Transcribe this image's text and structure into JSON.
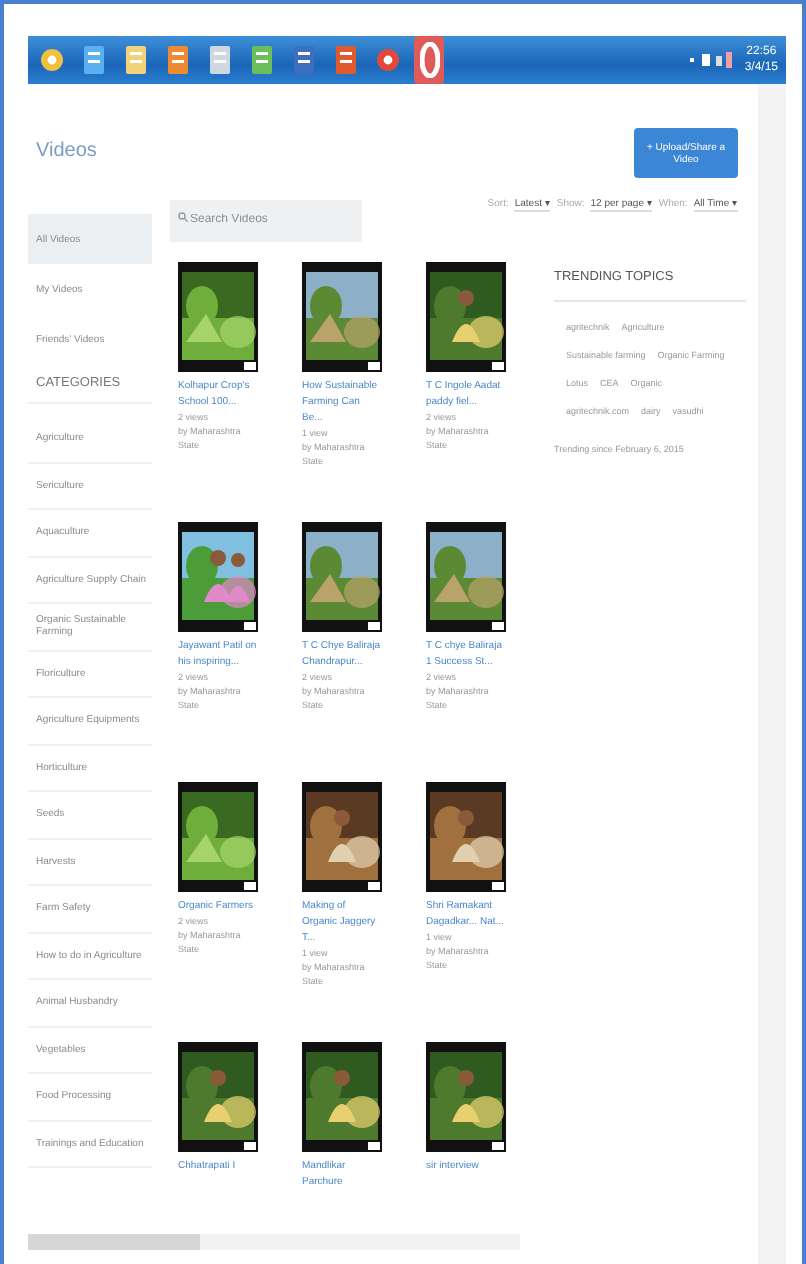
{
  "taskbar": {
    "apps": [
      {
        "kind": "start",
        "selected": false
      },
      {
        "kind": "ie",
        "selected": false
      },
      {
        "kind": "folder",
        "selected": false
      },
      {
        "kind": "media",
        "selected": false
      },
      {
        "kind": "doc",
        "selected": false
      },
      {
        "kind": "sheet",
        "selected": false
      },
      {
        "kind": "word",
        "selected": false
      },
      {
        "kind": "slides",
        "selected": false
      },
      {
        "kind": "chrome",
        "selected": false
      },
      {
        "kind": "opera",
        "selected": true
      }
    ],
    "clock": {
      "time": "22:56",
      "date": "3/4/15"
    }
  },
  "page": {
    "title": "Videos",
    "upload_button": "+ Upload/Share a Video"
  },
  "sidebar": {
    "items": [
      {
        "label": "All Videos",
        "selected": true
      },
      {
        "label": "My Videos",
        "selected": false
      },
      {
        "label": "Friends' Videos",
        "selected": false
      }
    ],
    "categories_heading": "CATEGORIES",
    "categories": [
      "Agriculture",
      "Sericulture",
      "Aquaculture",
      "Agriculture Supply Chain",
      "Organic Sustainable Farming",
      "Floriculture",
      "Agriculture Equipments",
      "Horticulture",
      "Seeds",
      "Harvests",
      "Farm Safety",
      "How to do in Agriculture",
      "Animal Husbandry",
      "Vegetables",
      "Food Processing",
      "Trainings and Education"
    ]
  },
  "search": {
    "placeholder": "Search Videos"
  },
  "filters": [
    {
      "label": "Sort:",
      "value": "Latest ▾"
    },
    {
      "label": "Show:",
      "value": "12 per page ▾"
    },
    {
      "label": "When:",
      "value": "All Time ▾"
    }
  ],
  "videos": [
    {
      "title": "Kolhapur Crop's School 100...",
      "views": "2 views",
      "author": "by Maharashtra State"
    },
    {
      "title": "How Sustainable Farming Can Be...",
      "views": "1 view",
      "author": "by Maharashtra State"
    },
    {
      "title": "T C Ingole Aadat paddy fiel...",
      "views": "2 views",
      "author": "by Maharashtra State"
    },
    {
      "title": "Jayawant Patil on his inspiring...",
      "views": "2 views",
      "author": "by Maharashtra State"
    },
    {
      "title": "T C Chye Baliraja Chandrapur...",
      "views": "2 views",
      "author": "by Maharashtra State"
    },
    {
      "title": "T C chye Baliraja 1 Success St...",
      "views": "2 views",
      "author": "by Maharashtra State"
    },
    {
      "title": "Organic Farmers",
      "views": "2 views",
      "author": "by Maharashtra State"
    },
    {
      "title": "Making of Organic Jaggery T...",
      "views": "1 view",
      "author": "by Maharashtra State"
    },
    {
      "title": "Shri Ramakant Dagadkar... Nat...",
      "views": "1 view",
      "author": "by Maharashtra State"
    },
    {
      "title": "Chhatrapati I"
    },
    {
      "title": "Mandlikar Parchure"
    },
    {
      "title": "sir interview"
    }
  ],
  "trending": {
    "heading": "TRENDING TOPICS",
    "tags": [
      "agritechnik",
      "Agriculture",
      "Sustainable farming",
      "Organic Farming",
      "Lotus",
      "CEA",
      "Organic",
      "agritechnik.com",
      "dairy",
      "vasudhi"
    ],
    "note": "Trending since February 6, 2015"
  }
}
